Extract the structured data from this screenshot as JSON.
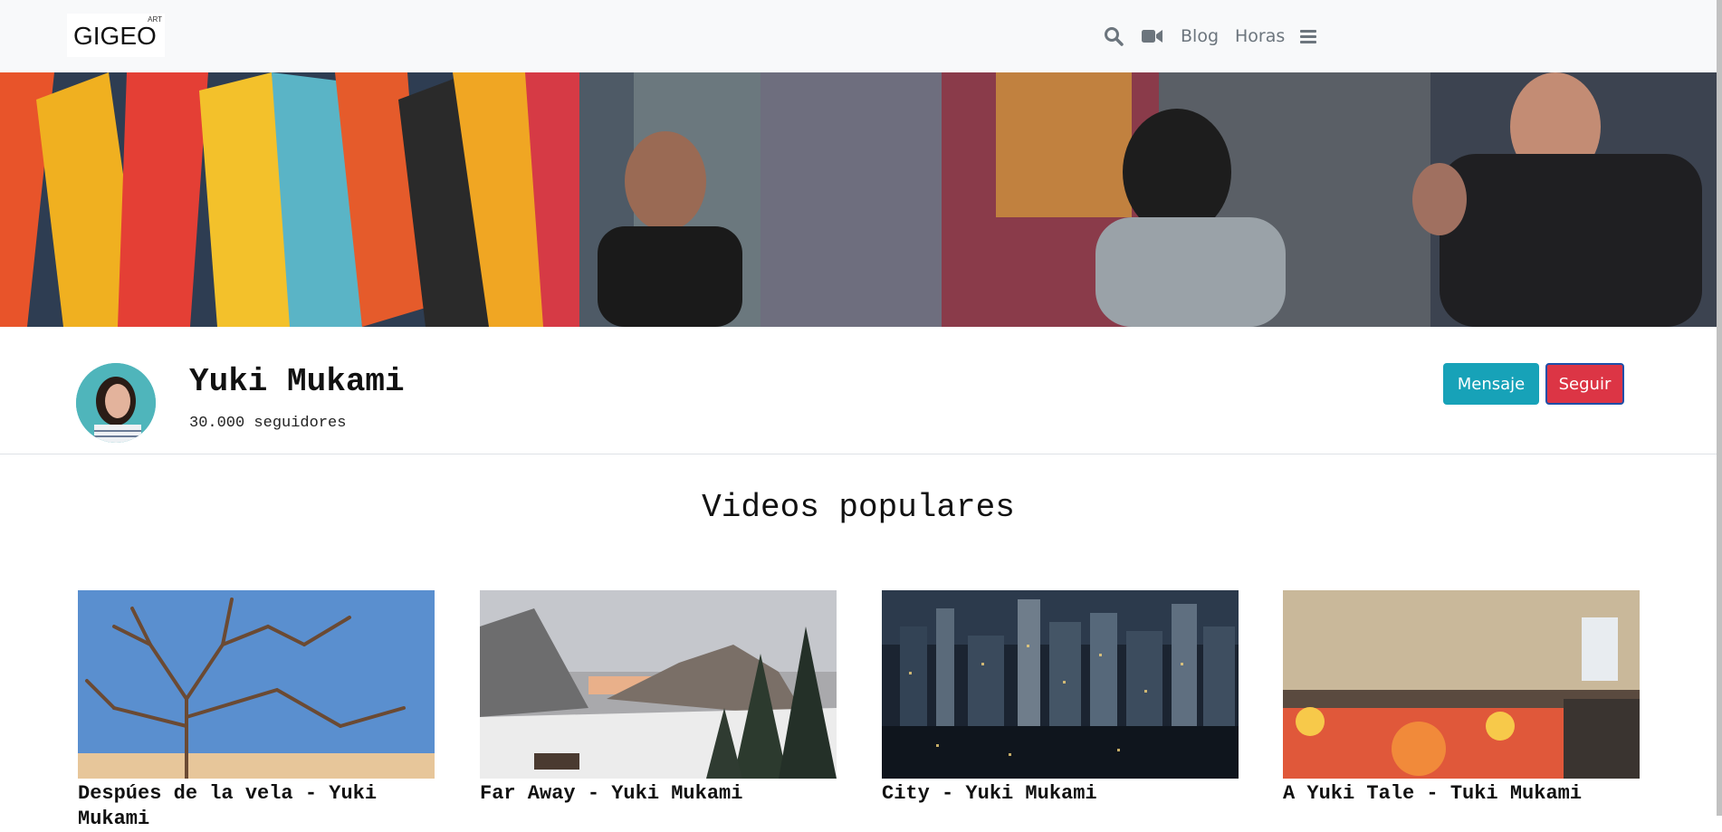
{
  "brand": {
    "name": "GIGEO",
    "tag": "ART"
  },
  "nav": {
    "blog": "Blog",
    "horas": "Horas",
    "icons": [
      "search-icon",
      "video-camera-icon",
      "hamburger-menu-icon"
    ]
  },
  "profile": {
    "name": "Yuki Mukami",
    "followers": "30.000 seguidores"
  },
  "actions": {
    "message": "Mensaje",
    "follow": "Seguir"
  },
  "colors": {
    "message_button": "#17a2b8",
    "follow_button": "#dc3545",
    "navbar_bg": "#f8f9fa"
  },
  "section": {
    "title": "Videos populares"
  },
  "videos": [
    {
      "title": "Despúes de la vela - Yuki Mukami"
    },
    {
      "title": "Far Away - Yuki Mukami"
    },
    {
      "title": "City - Yuki Mukami"
    },
    {
      "title": "A Yuki Tale - Tuki Mukami"
    }
  ]
}
